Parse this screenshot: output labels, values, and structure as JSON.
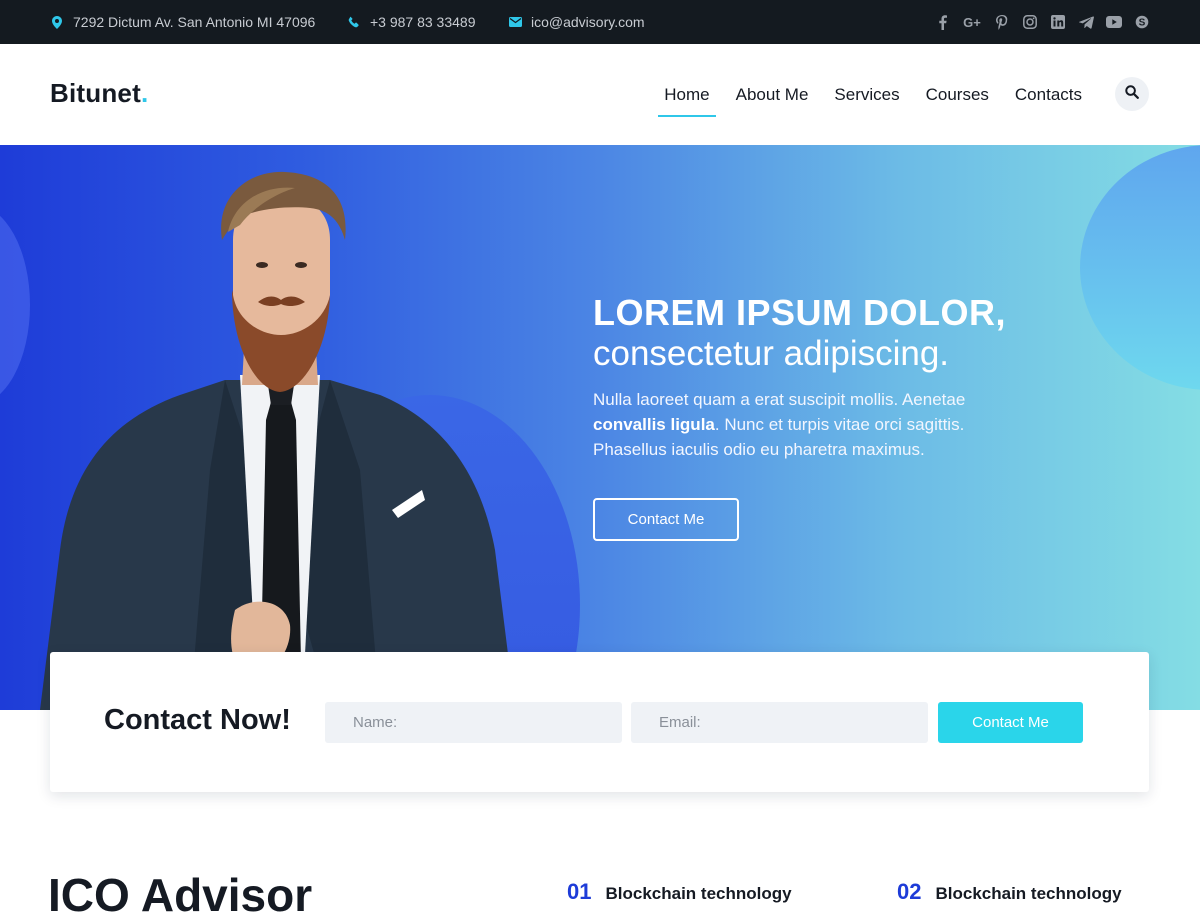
{
  "topbar": {
    "address": "7292 Dictum Av. San Antonio MI 47096",
    "phone": "+3 987 83 33489",
    "email": "ico@advisory.com",
    "social_icons": [
      "facebook-icon",
      "google-plus-icon",
      "pinterest-icon",
      "instagram-icon",
      "linkedin-icon",
      "telegram-icon",
      "youtube-icon",
      "skype-icon"
    ]
  },
  "header": {
    "logo_text": "Bitunet",
    "logo_dot": ".",
    "nav": [
      {
        "label": "Home",
        "active": true
      },
      {
        "label": "About Me",
        "active": false
      },
      {
        "label": "Services",
        "active": false
      },
      {
        "label": "Courses",
        "active": false
      },
      {
        "label": "Contacts",
        "active": false
      }
    ]
  },
  "hero": {
    "title": "LOREM IPSUM DOLOR,",
    "subtitle": "consectetur adipiscing.",
    "body_before": "Nulla laoreet quam a erat suscipit mollis. Aenetae",
    "body_bold": "convallis ligula",
    "body_after": ". Nunc et turpis vitae orci sagittis. Phasellus iaculis odio eu pharetra maximus.",
    "button_label": "Contact Me"
  },
  "contact": {
    "title": "Contact Now!",
    "name_placeholder": "Name:",
    "email_placeholder": "Email:",
    "submit_label": "Contact Me"
  },
  "section": {
    "title": "ICO Advisor",
    "features": [
      {
        "number": "01",
        "label": "Blockchain technology"
      },
      {
        "number": "02",
        "label": "Blockchain technology"
      }
    ]
  },
  "colors": {
    "accent": "#2fc7e9",
    "topbar_bg": "#141a20",
    "hero_gradient_start": "#1e3cd8",
    "hero_gradient_end": "#84dde4",
    "feature_number": "#1e3cd8",
    "submit_bg": "#2ad5ea"
  }
}
